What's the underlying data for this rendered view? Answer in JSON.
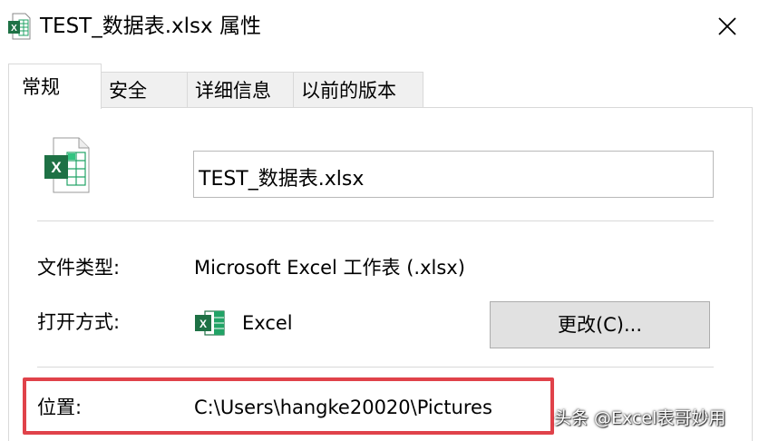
{
  "window": {
    "title": "TEST_数据表.xlsx 属性",
    "icon": "excel-file-icon"
  },
  "tabs": [
    {
      "label": "常规",
      "active": true
    },
    {
      "label": "安全",
      "active": false
    },
    {
      "label": "详细信息",
      "active": false
    },
    {
      "label": "以前的版本",
      "active": false
    }
  ],
  "general": {
    "filename": "TEST_数据表.xlsx",
    "file_type_label": "文件类型:",
    "file_type_value": "Microsoft Excel 工作表 (.xlsx)",
    "open_with_label": "打开方式:",
    "open_with_app": "Excel",
    "change_button": "更改(C)...",
    "location_label": "位置:",
    "location_value": "C:\\Users\\hangke20020\\Pictures"
  },
  "watermark": "头条 @Excel表哥妙用",
  "colors": {
    "highlight": "#e0424a",
    "excel_green": "#1e7145",
    "button_bg": "#e1e1e1"
  }
}
